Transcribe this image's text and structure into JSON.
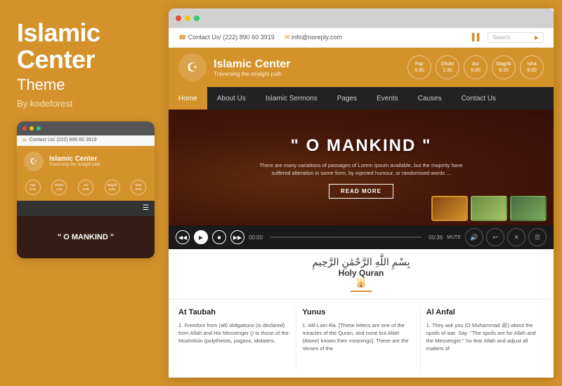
{
  "left": {
    "title_line1": "Islamic",
    "title_line2": "Center",
    "subtitle": "Theme",
    "by": "By kodeforest"
  },
  "mobile": {
    "contact": "Contact Us/ (222) 890 60 3919",
    "site_name": "Islamic Center",
    "tagline": "Traversing the straight path",
    "prayer_times": [
      {
        "name": "Fajr",
        "time": "5:30"
      },
      {
        "name": "Dhuhr",
        "time": "1:35"
      },
      {
        "name": "Asr",
        "time": "5:08"
      },
      {
        "name": "Magrib",
        "time": "6:00"
      },
      {
        "name": "Isha",
        "time": "8:00"
      }
    ],
    "hero_text": "\" O MANKIND \""
  },
  "browser": {
    "top_bar": {
      "contact": "Contact Us/ (222) 890 60 3919",
      "email": "info@noreply.com",
      "search_placeholder": "Search"
    },
    "header": {
      "site_name": "Islamic Center",
      "tagline": "Traversing the straight path",
      "prayer_times": [
        {
          "name": "Fajr",
          "time": "5:30"
        },
        {
          "name": "Dhuhr",
          "time": "1:30"
        },
        {
          "name": "Asr",
          "time": "5:00"
        },
        {
          "name": "Magrib",
          "time": "6:30"
        },
        {
          "name": "Isha",
          "time": "9:00"
        }
      ]
    },
    "nav": {
      "items": [
        "Home",
        "About Us",
        "Islamic Sermons",
        "Pages",
        "Events",
        "Causes",
        "Contact Us"
      ],
      "active": "Home"
    },
    "hero": {
      "quote": "\" O MANKIND \"",
      "description": "There are many variations of passages of Lorem Ipsum available, but the majority have suffered alteration in some form, by injected humour, or randomised words ...",
      "button": "READ MORE"
    },
    "audio": {
      "time_start": "00:00",
      "time_end": "00:36",
      "mute_label": "MUTE"
    },
    "quran": {
      "arabic": "بِسْمِ اللَّهِ الرَّحْمَٰنِ الرَّحِيمِ",
      "label": "Holy Quran"
    },
    "columns": [
      {
        "title": "At Taubah",
        "text": "1. Freedom from (all) obligations (is declared) from Allah and His Messenger () to those of the Mushrikûn (polytheists, pagans, idolaters,"
      },
      {
        "title": "Yunus",
        "text": "1. Alif-Lam-Ra. [These letters are one of the miracles of the Quran, and none but Allah (Alone) knows their meanings]. These are the Verses of the"
      },
      {
        "title": "Al Anfal",
        "text": "1. They ask you (O Muhammad ﷺ) about the spoils of war. Say: \"The spoils are for Allah and the Messenger.\" So fear Allah and adjust all matters of"
      }
    ]
  },
  "colors": {
    "accent": "#D4922A",
    "dark": "#222",
    "text": "#555"
  }
}
